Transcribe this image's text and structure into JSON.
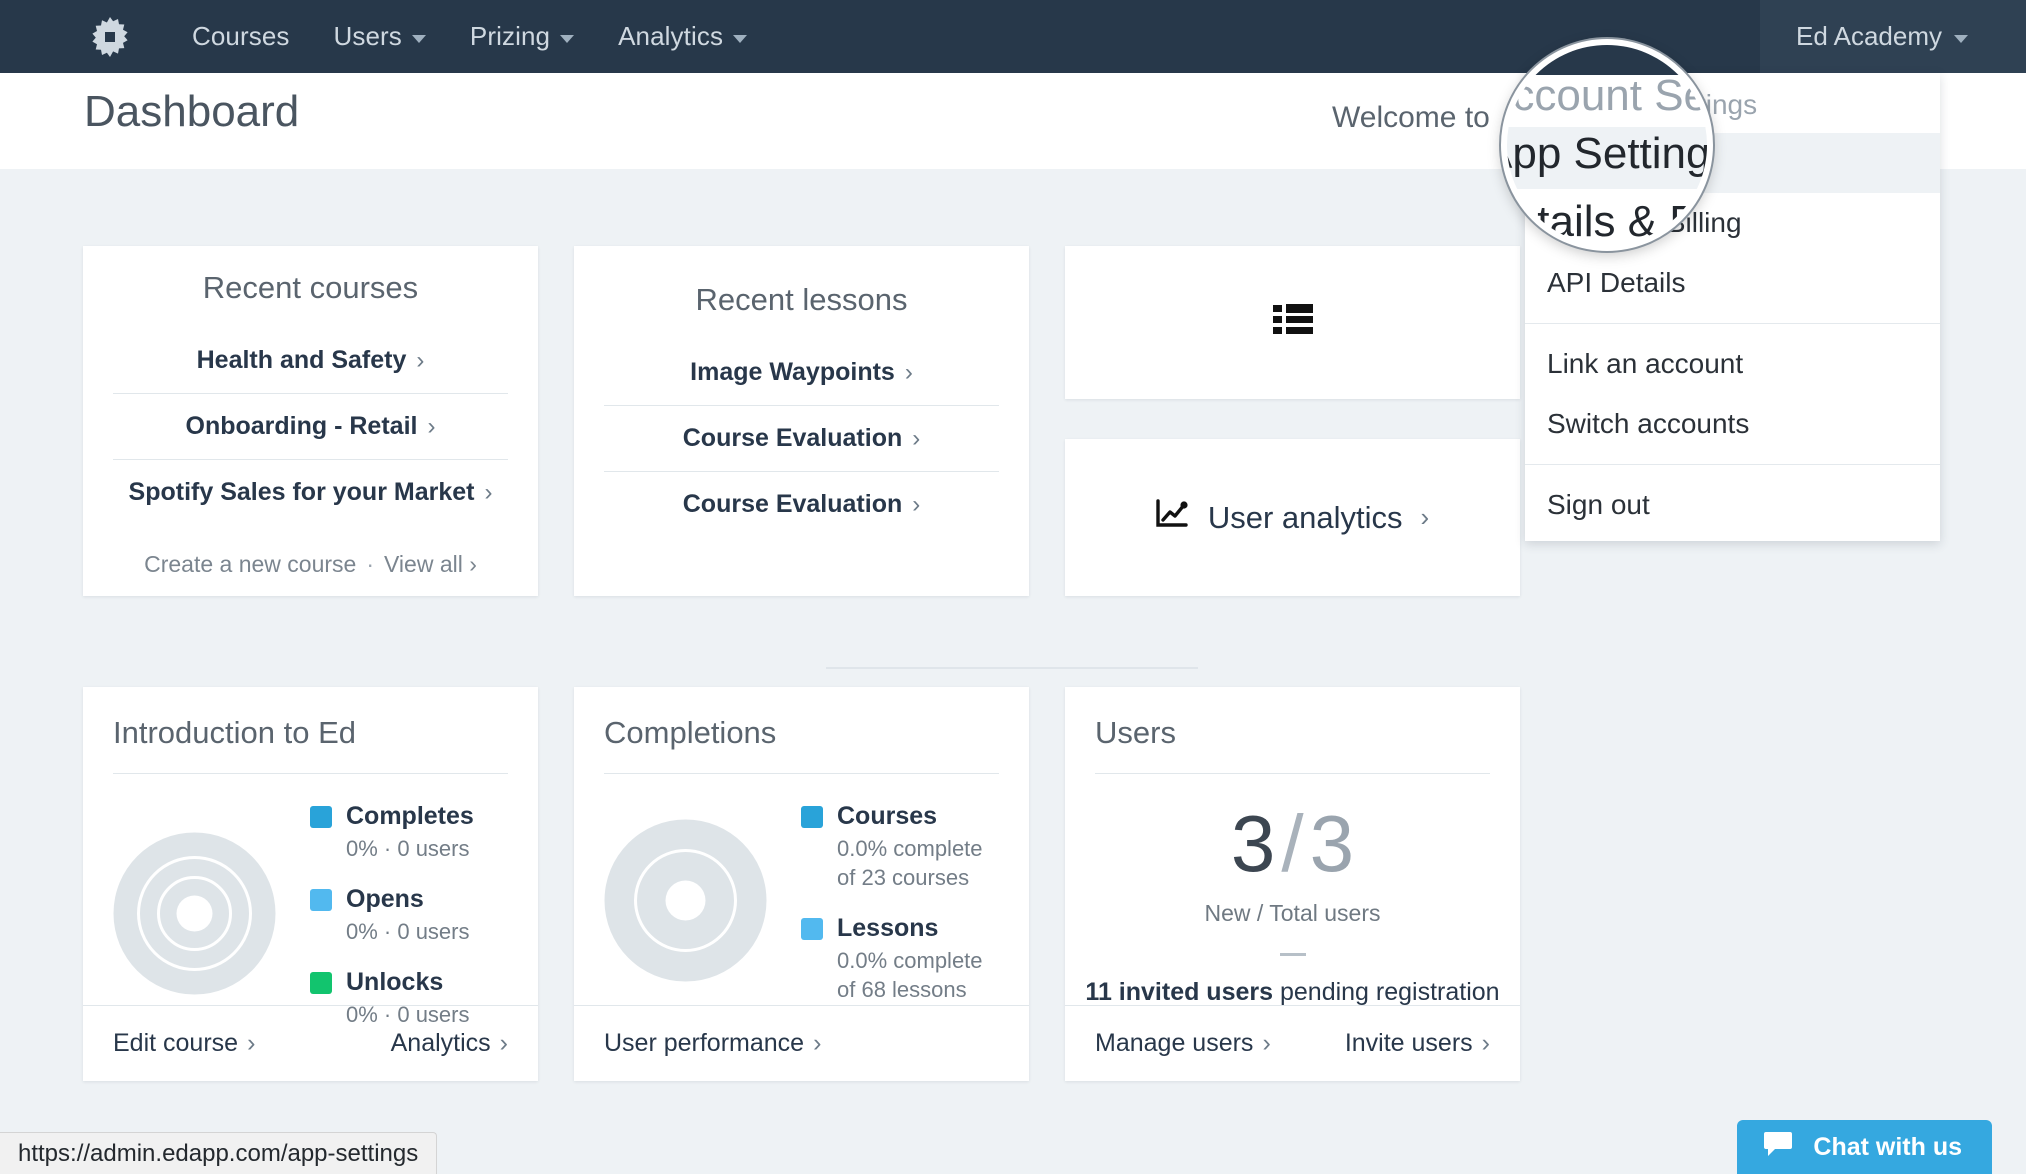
{
  "navbar": {
    "logo_icon": "gear-icon",
    "links": [
      {
        "label": "Courses",
        "has_caret": false
      },
      {
        "label": "Users",
        "has_caret": true
      },
      {
        "label": "Prizing",
        "has_caret": true
      },
      {
        "label": "Analytics",
        "has_caret": true
      }
    ],
    "account_label": "Ed Academy"
  },
  "header": {
    "title": "Dashboard",
    "welcome": "Welcome to"
  },
  "dropdown": {
    "header": "Account Settings",
    "items": [
      {
        "label": "App Settings",
        "active": true
      },
      {
        "label": "Details & Billing",
        "active": false
      },
      {
        "label": "API Details",
        "active": false
      },
      {
        "label": "Link an account",
        "active": false
      },
      {
        "label": "Switch accounts",
        "active": false
      },
      {
        "label": "Sign out",
        "active": false
      }
    ]
  },
  "magnifier": {
    "line1": "Account Settin",
    "line2": "App Settings",
    "line3": "Details & Bill"
  },
  "recent_courses": {
    "title": "Recent courses",
    "items": [
      {
        "label": "Health and Safety"
      },
      {
        "label": "Onboarding - Retail"
      },
      {
        "label": "Spotify Sales for your Market"
      }
    ],
    "create_label": "Create a new course",
    "separator": "·",
    "view_all_label": "View all"
  },
  "recent_lessons": {
    "title": "Recent lessons",
    "items": [
      {
        "label": "Image Waypoints"
      },
      {
        "label": "Course Evaluation"
      },
      {
        "label": "Course Evaluation"
      }
    ]
  },
  "list_card": {
    "icon": "bulleted-list-icon"
  },
  "analytics_card": {
    "icon": "line-chart-icon",
    "label": "User analytics"
  },
  "introduction_card": {
    "title": "Introduction to Ed",
    "chart_data": {
      "type": "pie",
      "title": "Introduction to Ed",
      "categories": [
        "Completes",
        "Opens",
        "Unlocks"
      ],
      "values": [
        0,
        0,
        0
      ],
      "value_labels": [
        "0% · 0 users",
        "0% · 0 users",
        "0% · 0 users"
      ],
      "colors": [
        "#29a3d9",
        "#52b9ef",
        "#12c46e"
      ],
      "empty_color": "#dde3e8",
      "legend_position": "right",
      "grid": false
    },
    "footer_left": "Edit course",
    "footer_right": "Analytics"
  },
  "completions_card": {
    "title": "Completions",
    "chart_data": {
      "type": "pie",
      "title": "Completions",
      "categories": [
        "Courses",
        "Lessons"
      ],
      "values": [
        0.0,
        0.0
      ],
      "value_labels": [
        "0.0% complete\nof 23 courses",
        "0.0% complete\nof 68 lessons"
      ],
      "totals": [
        23,
        68
      ],
      "colors": [
        "#29a3d9",
        "#52b9ef"
      ],
      "empty_color": "#dde3e8",
      "legend_position": "right",
      "grid": false
    },
    "legend": [
      {
        "label": "Courses",
        "line1": "0.0% complete",
        "line2": "of 23 courses",
        "color": "#29a3d9"
      },
      {
        "label": "Lessons",
        "line1": "0.0% complete",
        "line2": "of 68 lessons",
        "color": "#52b9ef"
      }
    ],
    "footer_left": "User performance"
  },
  "intro_legend": [
    {
      "label": "Completes",
      "sub": "0% · 0 users",
      "color": "#29a3d9"
    },
    {
      "label": "Opens",
      "sub": "0% · 0 users",
      "color": "#52b9ef"
    },
    {
      "label": "Unlocks",
      "sub": "0% · 0 users",
      "color": "#12c46e"
    }
  ],
  "users_card": {
    "title": "Users",
    "new_count": "3",
    "slash": "/",
    "total_count": "3",
    "caption": "New / Total users",
    "pending_bold": "11 invited users",
    "pending_rest": " pending registration",
    "footer_left": "Manage users",
    "footer_right": "Invite users"
  },
  "status_bar": {
    "url": "https://admin.edapp.com/app-settings"
  },
  "chat": {
    "icon": "chat-bubble-icon",
    "label": "Chat with us"
  },
  "colors": {
    "navbar_bg": "#27384a",
    "page_bg": "#eef2f5",
    "card_bg": "#ffffff",
    "accent_blue": "#29a3d9",
    "light_blue": "#52b9ef",
    "green": "#12c46e",
    "chat_blue": "#35a8e0"
  }
}
